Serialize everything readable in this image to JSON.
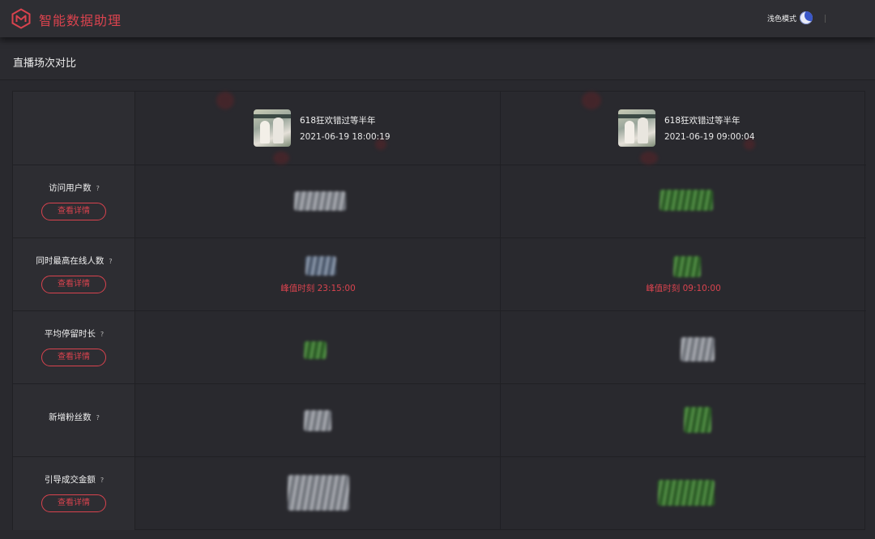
{
  "app": {
    "title": "智能数据助理",
    "brand_color": "#d9434e",
    "logo_icon": "cube-m-logo"
  },
  "topbar": {
    "mode_label": "浅色模式",
    "mode_icon": "moon-icon"
  },
  "page": {
    "section_title": "直播场次对比"
  },
  "sessions": [
    {
      "name": "618狂欢错过等半年",
      "time": "2021-06-19 18:00:19"
    },
    {
      "name": "618狂欢错过等半年",
      "time": "2021-06-19 09:00:04"
    }
  ],
  "metrics": [
    {
      "label": "访问用户数",
      "help": "?",
      "detail_button": "查看详情"
    },
    {
      "label": "同时最高在线人数",
      "help": "?",
      "detail_button": "查看详情",
      "peak_a": "峰值时刻 23:15:00",
      "peak_b": "峰值时刻 09:10:00"
    },
    {
      "label": "平均停留时长",
      "help": "?",
      "detail_button": "查看详情"
    },
    {
      "label": "新增粉丝数",
      "help": "?"
    },
    {
      "label": "引导成交金额",
      "help": "?",
      "detail_button": "查看详情"
    }
  ]
}
